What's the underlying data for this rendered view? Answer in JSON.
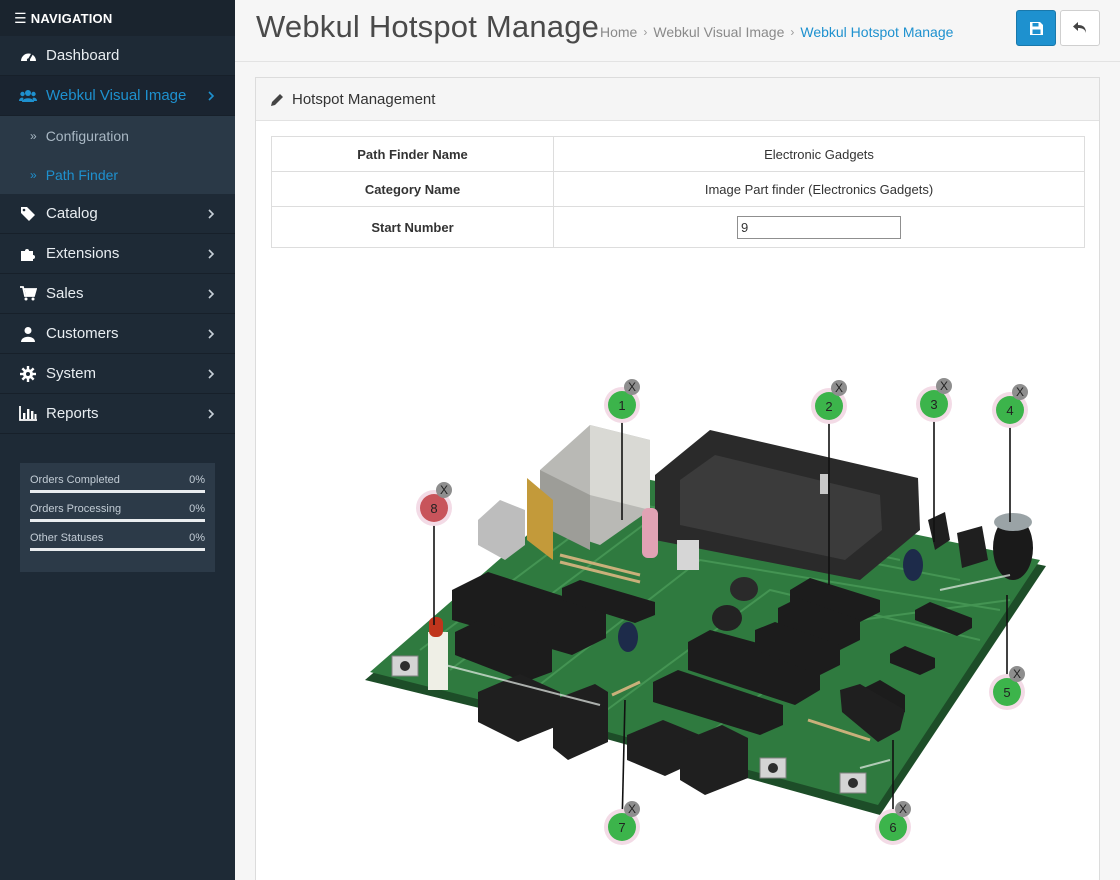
{
  "sidebar": {
    "nav_title": "NAVIGATION",
    "items": [
      {
        "label": "Dashboard",
        "icon": "dashboard-icon"
      },
      {
        "label": "Webkul Visual Image",
        "icon": "users-icon",
        "active": true
      },
      {
        "label": "Catalog",
        "icon": "tags-icon"
      },
      {
        "label": "Extensions",
        "icon": "puzzle-icon"
      },
      {
        "label": "Sales",
        "icon": "cart-icon"
      },
      {
        "label": "Customers",
        "icon": "user-icon"
      },
      {
        "label": "System",
        "icon": "cog-icon"
      },
      {
        "label": "Reports",
        "icon": "bar-chart-icon"
      }
    ],
    "subitems": [
      {
        "label": "Configuration"
      },
      {
        "label": "Path Finder",
        "active": true
      }
    ],
    "stats": [
      {
        "label": "Orders Completed",
        "value": "0%"
      },
      {
        "label": "Orders Processing",
        "value": "0%"
      },
      {
        "label": "Other Statuses",
        "value": "0%"
      }
    ]
  },
  "header": {
    "title": "Webkul Hotspot Manage",
    "breadcrumb": [
      "Home",
      "Webkul Visual Image",
      "Webkul Hotspot Manage"
    ]
  },
  "panel": {
    "title": "Hotspot Management",
    "rows": [
      {
        "key": "Path Finder Name",
        "value": "Electronic Gadgets"
      },
      {
        "key": "Category Name",
        "value": "Image Part finder (Electronics Gadgets)"
      },
      {
        "key": "Start Number",
        "value": "9"
      }
    ]
  },
  "hotspots": [
    {
      "number": "1",
      "remove": "X",
      "color": "#3cb44b"
    },
    {
      "number": "2",
      "remove": "X",
      "color": "#3cb44b"
    },
    {
      "number": "3",
      "remove": "X",
      "color": "#3cb44b"
    },
    {
      "number": "4",
      "remove": "X",
      "color": "#3cb44b"
    },
    {
      "number": "5",
      "remove": "X",
      "color": "#3cb44b"
    },
    {
      "number": "6",
      "remove": "X",
      "color": "#3cb44b"
    },
    {
      "number": "7",
      "remove": "X",
      "color": "#3cb44b"
    },
    {
      "number": "8",
      "remove": "X",
      "color": "#c8545b"
    }
  ],
  "colors": {
    "accent": "#1e91cf",
    "sidebar": "#1e2a36",
    "board": "#2f7a3f"
  }
}
